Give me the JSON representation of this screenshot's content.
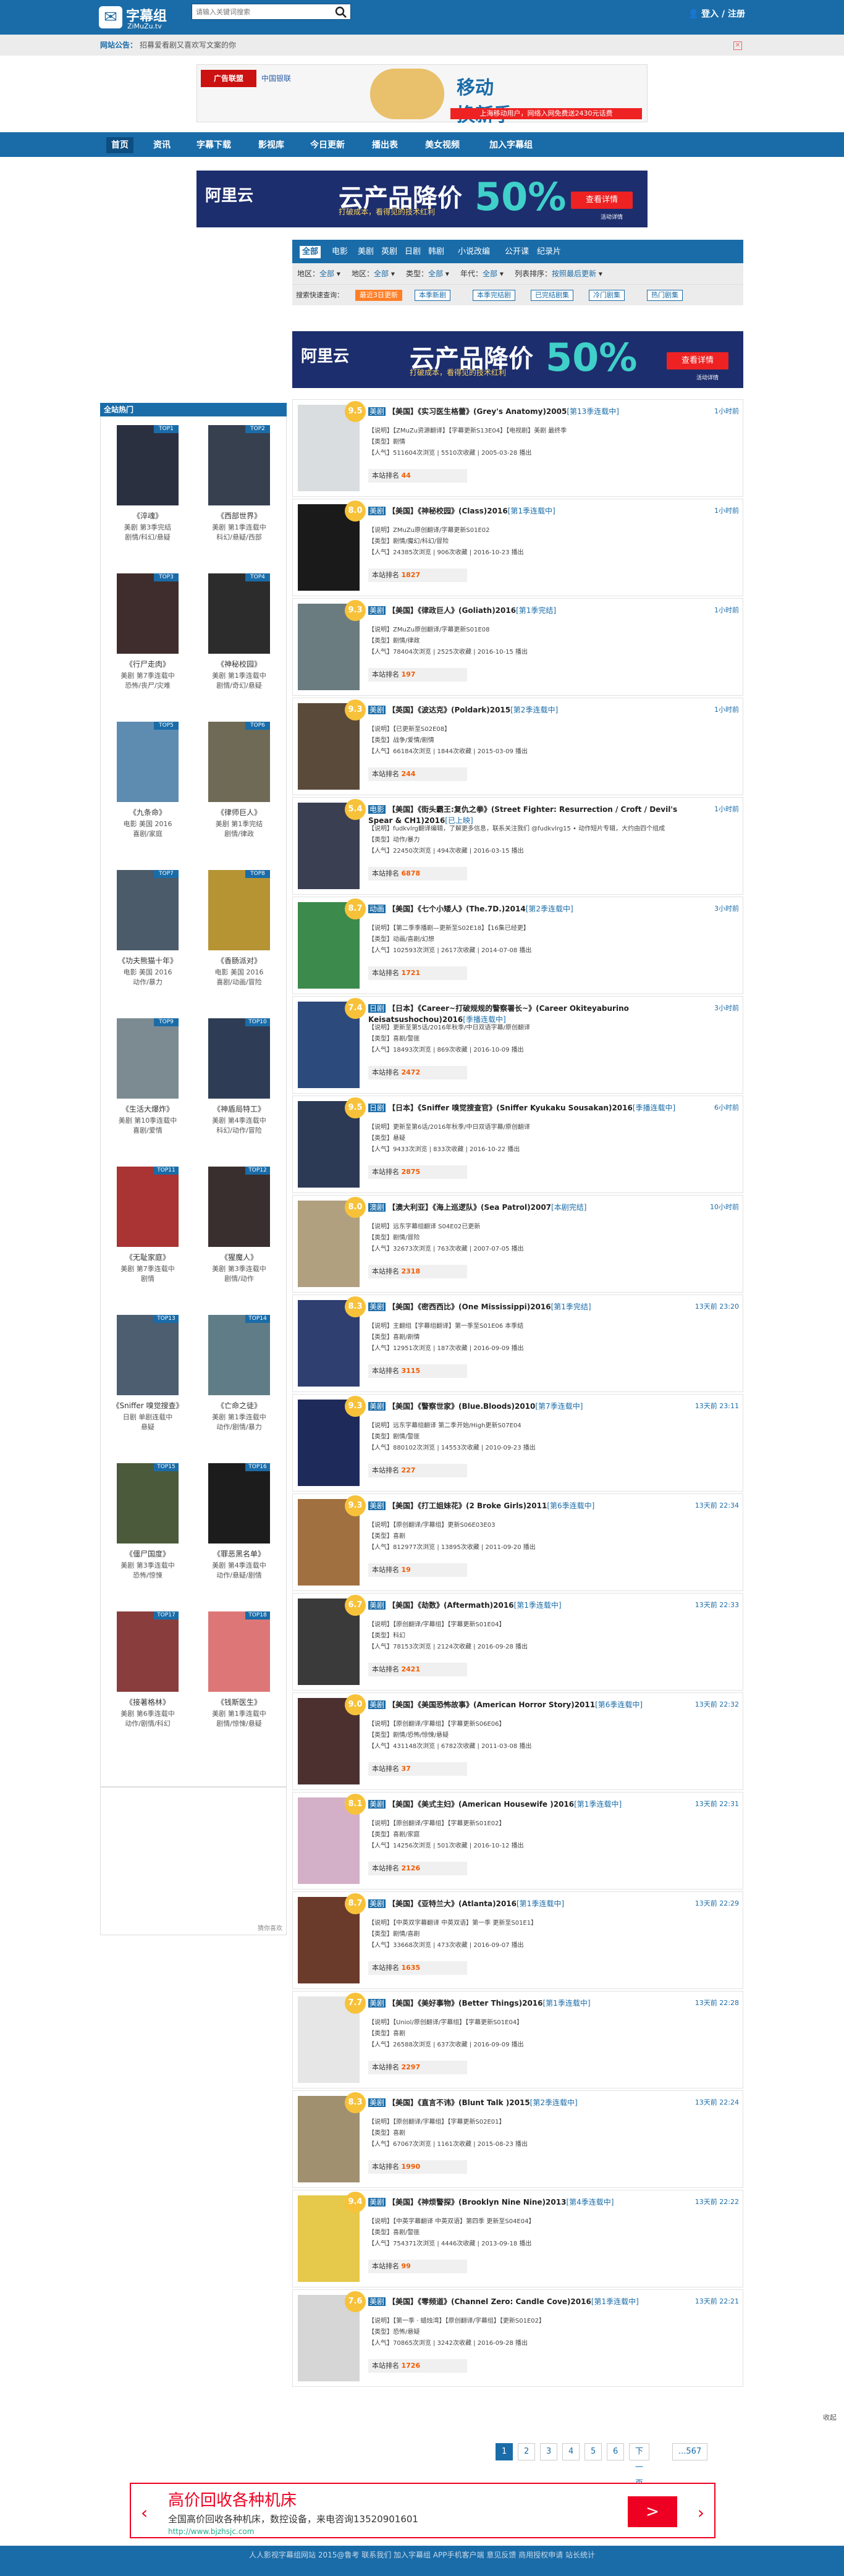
{
  "brand": {
    "name": "字幕组",
    "sub": "ZiMuZu.tv"
  },
  "search": {
    "placeholder": "请输入关键词搜索"
  },
  "login": {
    "label": "登入 / 注册"
  },
  "notice": {
    "label": "网站公告：",
    "text": "招募爱看剧又喜欢写文案的你"
  },
  "top_ad": {
    "brand1": "广告联盟",
    "brand2": "中国银联",
    "line1": "移动",
    "line2": "换新季",
    "strip": "上海移动用户，网络入网免费送2430元话费"
  },
  "nav": [
    "首页",
    "资讯",
    "字幕下载",
    "影视库",
    "今日更新",
    "播出表",
    "美女视频",
    "加入字幕组"
  ],
  "ali_ad": {
    "brand": "阿里云",
    "headline": "云产品降价",
    "sub": "打破成本，看得见的技术红利",
    "pct": "50%",
    "btn": "查看详情",
    "note": "活动详情"
  },
  "categories": [
    "全部",
    "电影",
    "美剧",
    "英剧",
    "日剧",
    "韩剧",
    "小说改编",
    "公开课",
    "纪录片"
  ],
  "filters": [
    {
      "label": "地区：",
      "value": "全部"
    },
    {
      "label": "地区：",
      "value": "全部"
    },
    {
      "label": "类型：",
      "value": "全部"
    },
    {
      "label": "年代：",
      "value": "全部"
    },
    {
      "label": "列表排序：",
      "value": "按照最后更新"
    }
  ],
  "presets": {
    "label": "搜索快速查询：",
    "items": [
      "最近3日更新",
      "本季新剧",
      "本季完结剧",
      "已完结剧集",
      "冷门剧集",
      "热门剧集"
    ]
  },
  "sidebar": {
    "title": "全站热门",
    "items": [
      {
        "title": "《淬魂》",
        "line1": "美剧 第3季完结",
        "line2": "剧情/科幻/悬疑",
        "badge": "TOP1"
      },
      {
        "title": "《西部世界》",
        "line1": "美剧 第1季连载中",
        "line2": "科幻/悬疑/西部",
        "badge": "TOP2"
      },
      {
        "title": "《行尸走肉》",
        "line1": "美剧 第7季连载中",
        "line2": "恐怖/丧尸/灾难",
        "badge": "TOP3"
      },
      {
        "title": "《神秘校园》",
        "line1": "美剧 第1季连载中",
        "line2": "剧情/奇幻/悬疑",
        "badge": "TOP4"
      },
      {
        "title": "《九条命》",
        "line1": "电影 美国 2016",
        "line2": "喜剧/家庭",
        "badge": "TOP5"
      },
      {
        "title": "《律师巨人》",
        "line1": "美剧 第1季完结",
        "line2": "剧情/律政",
        "badge": "TOP6"
      },
      {
        "title": "《功夫熊猫十年》",
        "line1": "电影 美国 2016",
        "line2": "动作/暴力",
        "badge": "TOP7"
      },
      {
        "title": "《香肠派对》",
        "line1": "电影 美国 2016",
        "line2": "喜剧/动画/冒险",
        "badge": "TOP8"
      },
      {
        "title": "《生活大爆炸》",
        "line1": "美剧 第10季连载中",
        "line2": "喜剧/爱情",
        "badge": "TOP9"
      },
      {
        "title": "《神盾局特工》",
        "line1": "美剧 第4季连载中",
        "line2": "科幻/动作/冒险",
        "badge": "TOP10"
      },
      {
        "title": "《无耻家庭》",
        "line1": "美剧 第7季连载中",
        "line2": "剧情",
        "badge": "TOP11"
      },
      {
        "title": "《猩魔人》",
        "line1": "美剧 第3季连载中",
        "line2": "剧情/动作",
        "badge": "TOP12"
      },
      {
        "title": "《Sniffer 嗅觉搜查》",
        "line1": "日剧 单剧连载中",
        "line2": "悬疑",
        "badge": "TOP13"
      },
      {
        "title": "《亡命之徒》",
        "line1": "美剧 第1季连载中",
        "line2": "动作/剧情/暴力",
        "badge": "TOP14"
      },
      {
        "title": "《僵尸国度》",
        "line1": "美剧 第3季连载中",
        "line2": "恐怖/惊悚",
        "badge": "TOP15"
      },
      {
        "title": "《罪恶黑名单》",
        "line1": "美剧 第4季连载中",
        "line2": "动作/悬疑/剧情",
        "badge": "TOP16"
      },
      {
        "title": "《接著格林》",
        "line1": "美剧 第6季连载中",
        "line2": "动作/剧情/科幻",
        "badge": "TOP17"
      },
      {
        "title": "《钱斯医生》",
        "line1": "美剧 第1季连载中",
        "line2": "剧情/惊悚/悬疑",
        "badge": "TOP18"
      }
    ],
    "footnote": "猜你喜欢"
  },
  "list": [
    {
      "tag": "美剧",
      "title": "【美国】《实习医生格蕾》(Grey's Anatomy)2005",
      "status": "[第13季连载中]",
      "time": "1小时前",
      "score": "9.5",
      "info1": "【说明】【ZMuZu资源翻译】【字幕更新S13E04】【电视剧】美剧 最终季",
      "info2": "【类型】剧情",
      "info3": "【人气】511604次浏览 | 5510次收藏 | 2005-03-28 播出",
      "rank": "44"
    },
    {
      "tag": "美剧",
      "title": "【美国】《神秘校园》(Class)2016",
      "status": "[第1季连载中]",
      "time": "1小时前",
      "score": "8.0",
      "info1": "【说明】ZMuZu原创翻译/字幕更新S01E02",
      "info2": "【类型】剧情/魔幻/科幻/冒险",
      "info3": "【人气】24385次浏览 | 906次收藏 | 2016-10-23 播出",
      "rank": "1827"
    },
    {
      "tag": "美剧",
      "title": "【美国】《律政巨人》(Goliath)2016",
      "status": "[第1季完结]",
      "time": "1小时前",
      "score": "9.3",
      "info1": "【说明】ZMuZu原创翻译/字幕更新S01E08",
      "info2": "【类型】剧情/律政",
      "info3": "【人气】78404次浏览 | 2525次收藏 | 2016-10-15 播出",
      "rank": "197"
    },
    {
      "tag": "美剧",
      "title": "【英国】《波达克》(Poldark)2015",
      "status": "[第2季连载中]",
      "time": "1小时前",
      "score": "9.3",
      "info1": "【说明】【已更新至S02E08】",
      "info2": "【类型】战争/爱情/剧情",
      "info3": "【人气】66184次浏览 | 1844次收藏 | 2015-03-09 播出",
      "rank": "244"
    },
    {
      "tag": "电影",
      "title": "【美国】《街头霸王:复仇之拳》(Street Fighter: Resurrection / Croft / Devil's Spear & CH1)2016",
      "status": "[已上映]",
      "time": "1小时前",
      "score": "5.4",
      "info1": "【说明】fudkvlrg翻译编辑，了解更多信息，联系关注我们 @fudkvlrg15 • 动作短片专辑，大约由四个组成",
      "info2": "【类型】动作/暴力",
      "info3": "【人气】22450次浏览 | 494次收藏 | 2016-03-15 播出",
      "rank": "6878"
    },
    {
      "tag": "动画",
      "title": "【美国】《七个小矮人》(The.7D.)2014",
      "status": "[第2季连载中]",
      "time": "3小时前",
      "score": "8.7",
      "info1": "【说明】【第二季季播剧—更新至S02E18】【16集已经更】",
      "info2": "【类型】动画/喜剧/幻想",
      "info3": "【人气】102593次浏览 | 2617次收藏 | 2014-07-08 播出",
      "rank": "1721"
    },
    {
      "tag": "日剧",
      "title": "【日本】《Career~打破规规的警察署长~》(Career Okiteyaburino Keisatsushochou)2016",
      "status": "[季播连载中]",
      "time": "3小时前",
      "score": "7.4",
      "info1": "【说明】更新至第5话/2016年秋季/中日双语字幕/原创翻译",
      "info2": "【类型】喜剧/警匪",
      "info3": "【人气】18493次浏览 | 869次收藏 | 2016-10-09 播出",
      "rank": "2472"
    },
    {
      "tag": "日剧",
      "title": "【日本】《Sniffer 嗅觉搜查官》(Sniffer Kyukaku Sousakan)2016",
      "status": "[季播连载中]",
      "time": "6小时前",
      "score": "9.5",
      "info1": "【说明】更新至第6话/2016年秋季/中日双语字幕/原创翻译",
      "info2": "【类型】悬疑",
      "info3": "【人气】9433次浏览 | 833次收藏 | 2016-10-22 播出",
      "rank": "2875"
    },
    {
      "tag": "澳剧",
      "title": "【澳大利亚】《海上巡逻队》(Sea Patrol)2007",
      "status": "[本剧完结]",
      "time": "10小时前",
      "score": "8.0",
      "info1": "【说明】远东字幕组翻译 S04E02已更新",
      "info2": "【类型】剧情/冒险",
      "info3": "【人气】32673次浏览 | 763次收藏 | 2007-07-05 播出",
      "rank": "2318"
    },
    {
      "tag": "美剧",
      "title": "【美国】《密西西比》(One Mississippi)2016",
      "status": "[第1季完结]",
      "time": "13天前 23:20",
      "score": "8.3",
      "info1": "【说明】主翻组【字幕组翻译】第一季至S01E06 本季结",
      "info2": "【类型】喜剧/剧情",
      "info3": "【人气】12951次浏览 | 187次收藏 | 2016-09-09 播出",
      "rank": "3115"
    },
    {
      "tag": "美剧",
      "title": "【美国】《警察世家》(Blue.Bloods)2010",
      "status": "[第7季连载中]",
      "time": "13天前 23:11",
      "score": "9.3",
      "info1": "【说明】远东字幕组翻译 第二季开始/High更新S07E04",
      "info2": "【类型】剧情/警匪",
      "info3": "【人气】880102次浏览 | 14553次收藏 | 2010-09-23 播出",
      "rank": "227"
    },
    {
      "tag": "美剧",
      "title": "【美国】《打工姐妹花》(2 Broke Girls)2011",
      "status": "[第6季连载中]",
      "time": "13天前 22:34",
      "score": "9.3",
      "info1": "【说明】【原创翻译/字幕组】更新S06E03E03",
      "info2": "【类型】喜剧",
      "info3": "【人气】812977次浏览 | 13895次收藏 | 2011-09-20 播出",
      "rank": "19"
    },
    {
      "tag": "美剧",
      "title": "【美国】《劫数》(Aftermath)2016",
      "status": "[第1季连载中]",
      "time": "13天前 22:33",
      "score": "6.7",
      "info1": "【说明】【原创翻译/字幕组】【字幕更新S01E04】",
      "info2": "【类型】科幻",
      "info3": "【人气】78153次浏览 | 2124次收藏 | 2016-09-28 播出",
      "rank": "2421"
    },
    {
      "tag": "美剧",
      "title": "【美国】《美国恐怖故事》(American Horror Story)2011",
      "status": "[第6季连载中]",
      "time": "13天前 22:32",
      "score": "9.0",
      "info1": "【说明】【原创翻译/字幕组】【字幕更新S06E06】",
      "info2": "【类型】剧情/恐怖/惊悚/悬疑",
      "info3": "【人气】431148次浏览 | 6782次收藏 | 2011-03-08 播出",
      "rank": "37"
    },
    {
      "tag": "美剧",
      "title": "【美国】《美式主妇》(American Housewife )2016",
      "status": "[第1季连载中]",
      "time": "13天前 22:31",
      "score": "8.1",
      "info1": "【说明】【原创翻译/字幕组】【字幕更新S01E02】",
      "info2": "【类型】喜剧/家庭",
      "info3": "【人气】14256次浏览 | 501次收藏 | 2016-10-12 播出",
      "rank": "2126"
    },
    {
      "tag": "美剧",
      "title": "【美国】《亚特兰大》(Atlanta)2016",
      "status": "[第1季连载中]",
      "time": "13天前 22:29",
      "score": "8.7",
      "info1": "【说明】【中英双字幕翻译 中英双语】第一季 更新至S01E1】",
      "info2": "【类型】剧情/喜剧",
      "info3": "【人气】33668次浏览 | 473次收藏 | 2016-09-07 播出",
      "rank": "1635"
    },
    {
      "tag": "美剧",
      "title": "【美国】《美好事物》(Better Things)2016",
      "status": "[第1季连载中]",
      "time": "13天前 22:28",
      "score": "7.7",
      "info1": "【说明】【Uniol/原创翻译/字幕组】【字幕更新S01E04】",
      "info2": "【类型】喜剧",
      "info3": "【人气】26588次浏览 | 637次收藏 | 2016-09-09 播出",
      "rank": "2297"
    },
    {
      "tag": "美剧",
      "title": "【美国】《直言不讳》(Blunt Talk )2015",
      "status": "[第2季连载中]",
      "time": "13天前 22:24",
      "score": "8.3",
      "info1": "【说明】【原创翻译/字幕组】【字幕更新S02E01】",
      "info2": "【类型】喜剧",
      "info3": "【人气】67067次浏览 | 1161次收藏 | 2015-08-23 播出",
      "rank": "1990"
    },
    {
      "tag": "美剧",
      "title": "【美国】《神烦警探》(Brooklyn Nine Nine)2013",
      "status": "[第4季连载中]",
      "time": "13天前 22:22",
      "score": "9.4",
      "info1": "【说明】【中英字幕翻译 中英双语】第四季 更新至S04E04】",
      "info2": "【类型】喜剧/警匪",
      "info3": "【人气】754371次浏览 | 4446次收藏 | 2013-09-18 播出",
      "rank": "99"
    },
    {
      "tag": "美剧",
      "title": "【美国】《零频道》(Channel Zero: Candle Cove)2016",
      "status": "[第1季连载中]",
      "time": "13天前 22:21",
      "score": "7.6",
      "info1": "【说明】【第一季 · 蜡烛湾】【原创翻译/字幕组】【更新S01E02】",
      "info2": "【类型】恐怖/悬疑",
      "info3": "【人气】70865次浏览 | 3242次收藏 | 2016-09-28 播出",
      "rank": "1726"
    }
  ],
  "rank_label": "本站排名",
  "pager": {
    "pages": [
      "1",
      "2",
      "3",
      "4",
      "5",
      "6"
    ],
    "next": "下一页",
    "last": "...567"
  },
  "bottom_ad": {
    "title": "高价回收各种机床",
    "desc": "全国高价回收各种机床，数控设备，来电咨询13520901601",
    "url": "http://www.bjzhsjc.com",
    "btn": ">"
  },
  "footer": "人人影视字幕组网站 2015@鲁考 联系我们 加入字幕组 APP手机客户端 意见反馈 商用授权申请 站长统计",
  "corner": "收起"
}
